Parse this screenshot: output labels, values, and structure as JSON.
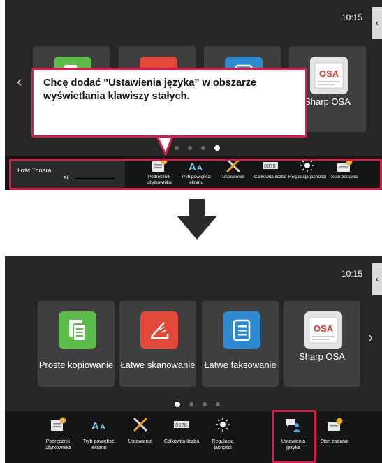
{
  "top_screen": {
    "time": "10:15",
    "side_tab": "‹",
    "tiles": [
      {
        "label": "",
        "icon": "copy-icon",
        "color": "#5dbb4a"
      },
      {
        "label": "",
        "icon": "scan-icon",
        "color": "#e14a3b"
      },
      {
        "label": "",
        "icon": "fax-icon",
        "color": "#2e89cf"
      },
      {
        "label": "Sharp OSA",
        "icon": "osa-icon"
      }
    ],
    "callout": "Chcę dodać \"Ustawienia języka” w obszarze wyświetlania klawiszy stałych.",
    "page_dots": {
      "count": 4,
      "active": 4
    },
    "toner": {
      "label": "Ilość Tonera",
      "color_label": "Bk"
    },
    "keys": [
      {
        "label": "Podręcznik użytkownika",
        "icon": "manual-icon"
      },
      {
        "label": "Tryb powiększ. ekranu",
        "icon": "enlarge-text-icon"
      },
      {
        "label": "Ustawienia",
        "icon": "settings-tools-icon"
      },
      {
        "label": "Całkowita liczba",
        "icon": "counter-icon"
      },
      {
        "label": "Regulacja jasności",
        "icon": "brightness-icon"
      },
      {
        "label": "Stan zadania",
        "icon": "job-status-icon"
      }
    ]
  },
  "bottom_screen": {
    "time": "10:15",
    "side_tab": "‹",
    "tiles": [
      {
        "label": "Proste kopiowanie",
        "icon": "copy-icon",
        "color": "#5dbb4a"
      },
      {
        "label": "Łatwe skanowanie",
        "icon": "scan-icon",
        "color": "#e14a3b"
      },
      {
        "label": "Łatwe faksowanie",
        "icon": "fax-icon",
        "color": "#2e89cf"
      },
      {
        "label": "Sharp OSA",
        "icon": "osa-icon"
      }
    ],
    "page_dots": {
      "count": 4,
      "active": 1
    },
    "keys": [
      {
        "label": "Podręcznik użytkownika",
        "icon": "manual-icon"
      },
      {
        "label": "Tryb powiększ. ekranu",
        "icon": "enlarge-text-icon"
      },
      {
        "label": "Ustawienia",
        "icon": "settings-tools-icon"
      },
      {
        "label": "Całkowita liczba",
        "icon": "counter-icon"
      },
      {
        "label": "Regulacja jasności",
        "icon": "brightness-icon"
      },
      {
        "label": "Ustawienia języka",
        "icon": "language-settings-icon"
      },
      {
        "label": "Stan zadania",
        "icon": "job-status-icon"
      }
    ]
  },
  "colors": {
    "highlight": "#d31f4d",
    "screen_bg": "#262626",
    "key_bar": "#151515"
  }
}
